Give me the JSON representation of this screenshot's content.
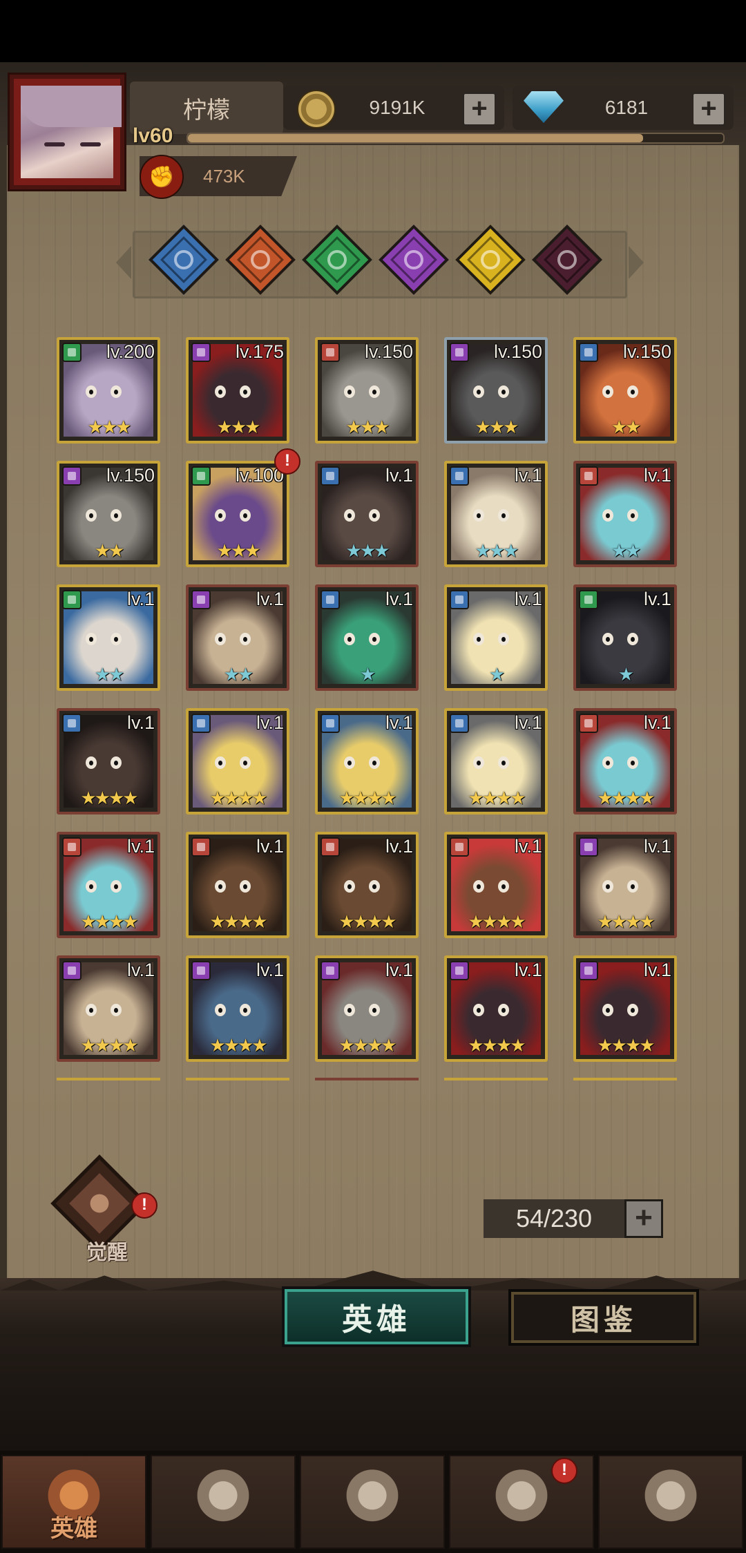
{
  "player": {
    "name": "柠檬",
    "level": "lv60",
    "exp_progress": 0.85,
    "power": "473K"
  },
  "resources": {
    "gold": "9191K",
    "diamonds": "6181",
    "plus": "+"
  },
  "filters": [
    {
      "icon": "wing-staff-icon",
      "color": "#3a6fb0"
    },
    {
      "icon": "sun-wheel-icon",
      "color": "#c2562a"
    },
    {
      "icon": "clover-icon",
      "color": "#2f9a4e"
    },
    {
      "icon": "eye-orb-icon",
      "color": "#8a3fb0"
    },
    {
      "icon": "sun-icon",
      "color": "#d9b21f"
    },
    {
      "icon": "dark-rune-icon",
      "color": "#4a1e2e"
    }
  ],
  "heroes": [
    {
      "level": "lv.200",
      "stars": "★★★",
      "badge": "#2f9a4e",
      "frame": "gold",
      "bg": [
        "#b8a7c4",
        "#6a5a7a"
      ]
    },
    {
      "level": "lv.175",
      "stars": "★★★",
      "badge": "#8a3fb0",
      "frame": "gold",
      "bg": [
        "#3a2a30",
        "#8a1d1d"
      ]
    },
    {
      "level": "lv.150",
      "stars": "★★★",
      "badge": "#b8453a",
      "frame": "gold",
      "bg": [
        "#9a9690",
        "#4a4640"
      ]
    },
    {
      "level": "lv.150",
      "stars": "★★★",
      "badge": "#8a3fb0",
      "frame": "silver",
      "bg": [
        "#5a5a5a",
        "#2a2424"
      ]
    },
    {
      "level": "lv.150",
      "stars": "★★",
      "badge": "#3a6fb0",
      "frame": "gold",
      "bg": [
        "#d2723e",
        "#6a2a1a"
      ]
    },
    {
      "level": "lv.150",
      "stars": "★★",
      "badge": "#8a3fb0",
      "frame": "gold",
      "bg": [
        "#8a8680",
        "#3a3632"
      ]
    },
    {
      "level": "lv.100",
      "stars": "★★★",
      "badge": "#2f9a4e",
      "frame": "gold",
      "bg": [
        "#6a4a8a",
        "#c8a060"
      ],
      "alert": "!"
    },
    {
      "level": "lv.1",
      "stars": "★★★",
      "badge": "#3a6fb0",
      "frame": "red",
      "bg": [
        "#5a4a44",
        "#2a2220"
      ]
    },
    {
      "level": "lv.1",
      "stars": "★★★",
      "badge": "#3a6fb0",
      "frame": "gold",
      "bg": [
        "#e8dcc2",
        "#8a7a6a"
      ]
    },
    {
      "level": "lv.1",
      "stars": "★★",
      "badge": "#b8453a",
      "frame": "red",
      "bg": [
        "#7acad2",
        "#8a2a2a"
      ]
    },
    {
      "level": "lv.1",
      "stars": "★★",
      "badge": "#2f9a4e",
      "frame": "gold",
      "bg": [
        "#dcd6ce",
        "#3a6aa0"
      ]
    },
    {
      "level": "lv.1",
      "stars": "★★",
      "badge": "#8a3fb0",
      "frame": "red",
      "bg": [
        "#c8b294",
        "#4a3a32"
      ]
    },
    {
      "level": "lv.1",
      "stars": "★",
      "badge": "#3a6fb0",
      "frame": "red",
      "bg": [
        "#3aa07a",
        "#2a3a32"
      ]
    },
    {
      "level": "lv.1",
      "stars": "★",
      "badge": "#3a6fb0",
      "frame": "gold",
      "bg": [
        "#f0e2b2",
        "#6a6a6a"
      ]
    },
    {
      "level": "lv.1",
      "stars": "★",
      "badge": "#2f9a4e",
      "frame": "red",
      "bg": [
        "#3a3a40",
        "#1a1a1e"
      ]
    },
    {
      "level": "lv.1",
      "stars": "★★★★",
      "badge": "#3a6fb0",
      "frame": "red",
      "bg": [
        "#4a3a34",
        "#1e1816"
      ]
    },
    {
      "level": "lv.1",
      "stars": "★★★★",
      "badge": "#3a6fb0",
      "frame": "gold",
      "bg": [
        "#e8cc6a",
        "#6a5a7a"
      ]
    },
    {
      "level": "lv.1",
      "stars": "★★★★",
      "badge": "#3a6fb0",
      "frame": "gold",
      "bg": [
        "#e8cc6a",
        "#4a6a8a"
      ]
    },
    {
      "level": "lv.1",
      "stars": "★★★★",
      "badge": "#3a6fb0",
      "frame": "gold",
      "bg": [
        "#f0e2b2",
        "#6a6a6a"
      ]
    },
    {
      "level": "lv.1",
      "stars": "★★★★",
      "badge": "#b8453a",
      "frame": "red",
      "bg": [
        "#7acad2",
        "#8a2a2a"
      ]
    },
    {
      "level": "lv.1",
      "stars": "★★★★",
      "badge": "#b8453a",
      "frame": "red",
      "bg": [
        "#7acad2",
        "#8a2a2a"
      ]
    },
    {
      "level": "lv.1",
      "stars": "★★★★",
      "badge": "#b8453a",
      "frame": "gold",
      "bg": [
        "#6a4a32",
        "#2a1e16"
      ]
    },
    {
      "level": "lv.1",
      "stars": "★★★★",
      "badge": "#b8453a",
      "frame": "gold",
      "bg": [
        "#6a4a32",
        "#2a1e16"
      ]
    },
    {
      "level": "lv.1",
      "stars": "★★★★",
      "badge": "#b8453a",
      "frame": "gold",
      "bg": [
        "#7a4a32",
        "#c83a3a"
      ]
    },
    {
      "level": "lv.1",
      "stars": "★★★★",
      "badge": "#8a3fb0",
      "frame": "red",
      "bg": [
        "#c8b294",
        "#4a3a32"
      ]
    },
    {
      "level": "lv.1",
      "stars": "★★★★",
      "badge": "#8a3fb0",
      "frame": "red",
      "bg": [
        "#c8b294",
        "#4a3a32"
      ]
    },
    {
      "level": "lv.1",
      "stars": "★★★★",
      "badge": "#8a3fb0",
      "frame": "gold",
      "bg": [
        "#4a6a8a",
        "#2a2a3a"
      ]
    },
    {
      "level": "lv.1",
      "stars": "★★★★",
      "badge": "#8a3fb0",
      "frame": "gold",
      "bg": [
        "#8a8680",
        "#6a2a2a"
      ]
    },
    {
      "level": "lv.1",
      "stars": "★★★★",
      "badge": "#8a3fb0",
      "frame": "gold",
      "bg": [
        "#3a2a30",
        "#8a1d1d"
      ]
    },
    {
      "level": "lv.1",
      "stars": "★★★★",
      "badge": "#8a3fb0",
      "frame": "gold",
      "bg": [
        "#3a2a30",
        "#8a1d1d"
      ]
    }
  ],
  "awaken": {
    "label": "觉醒",
    "alert": "!"
  },
  "hero_count": "54/230",
  "tabs": {
    "heroes": "英雄",
    "codex": "图鉴"
  },
  "bottom_nav": [
    {
      "label": "英雄",
      "icon": "helmet-icon",
      "active": true
    },
    {
      "label": "",
      "icon": "battle-flag-icon"
    },
    {
      "label": "",
      "icon": "crossed-swords-icon"
    },
    {
      "label": "",
      "icon": "castle-icon",
      "alert": "!"
    },
    {
      "label": "",
      "icon": "guild-handshake-icon"
    }
  ]
}
